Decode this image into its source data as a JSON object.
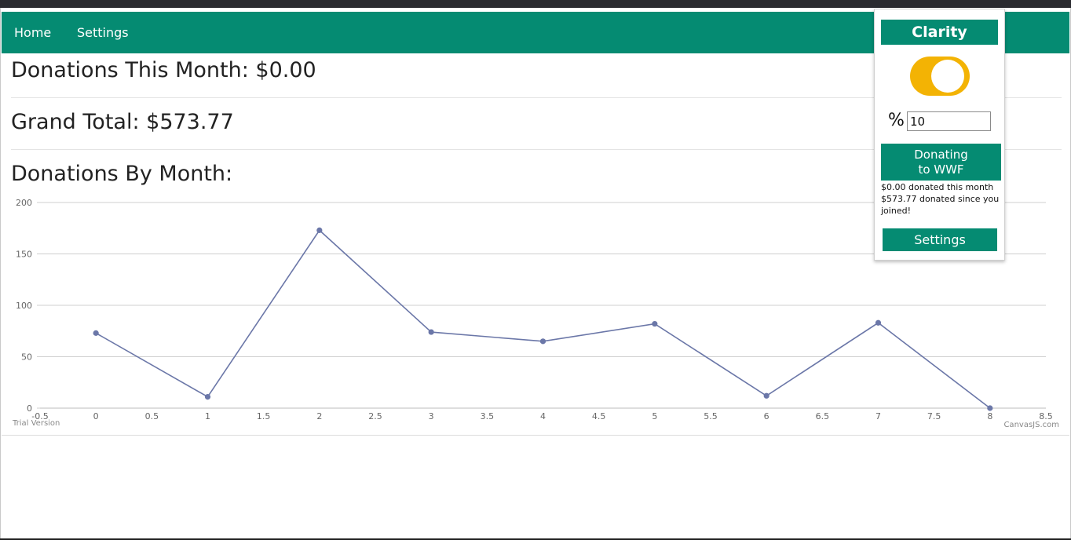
{
  "nav": {
    "home": "Home",
    "settings": "Settings"
  },
  "donations_this_month": "Donations This Month: $0.00",
  "grand_total": "Grand Total: $573.77",
  "donations_by_month": "Donations By Month:",
  "chart_data": {
    "type": "line",
    "x": [
      0,
      1,
      2,
      3,
      4,
      5,
      6,
      7,
      8
    ],
    "series": [
      {
        "values": [
          73,
          11,
          173,
          74,
          65,
          82,
          12,
          83,
          0
        ]
      }
    ],
    "xlim": [
      -0.5,
      8.5
    ],
    "ylim": [
      0,
      200
    ],
    "x_ticks": [
      -0.5,
      0,
      0.5,
      1,
      1.5,
      2,
      2.5,
      3,
      3.5,
      4,
      4.5,
      5,
      5.5,
      6,
      6.5,
      7,
      7.5,
      8,
      8.5
    ],
    "y_ticks": [
      0,
      50,
      100,
      150,
      200
    ],
    "grid": true,
    "line_color": "#6b77a8",
    "credit_left": "Trial Version",
    "credit_right": "CanvasJS.com"
  },
  "popup": {
    "brand": "Clarity",
    "toggle_on": true,
    "toggle_color": "#f3b304",
    "percent_symbol": "%",
    "percent_value": "10",
    "donating_line1": "Donating",
    "donating_line2": "to WWF",
    "month_note": "$0.00 donated this month",
    "total_note_line1": "$573.77 donated since you",
    "total_note_line2": "joined!",
    "settings_button": "Settings"
  },
  "colors": {
    "primary": "#058b72",
    "accent": "#f3b304"
  }
}
